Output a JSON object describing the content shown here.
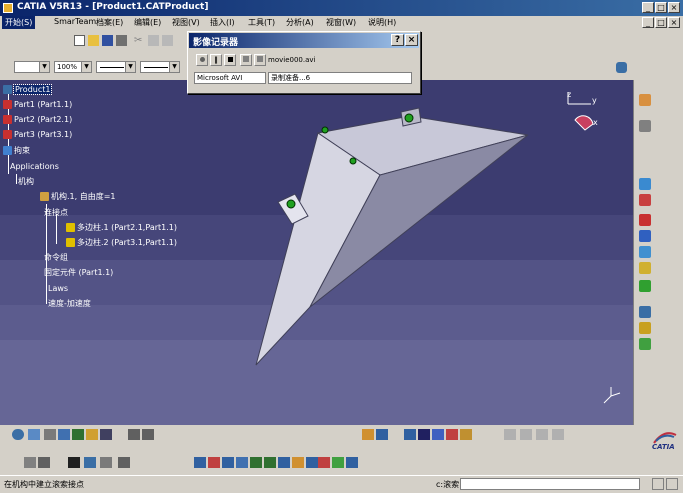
{
  "window": {
    "title": "CATIA V5R13 - [Product1.CATProduct]",
    "controls": [
      "_",
      "□",
      "×"
    ],
    "inner_controls": [
      "_",
      "□",
      "×"
    ]
  },
  "menu": {
    "start": "开始(S)",
    "items": [
      "SmarTeam",
      "档案(E)",
      "编辑(E)",
      "视图(V)",
      "插入(I)",
      "工具(T)",
      "分析(A)",
      "视窗(W)",
      "说明(H)"
    ]
  },
  "toolbar": {
    "zoom_value": "100%"
  },
  "recorder_dialog": {
    "title": "影像记录器",
    "help_label": "?",
    "close_label": "×",
    "filename": "movie000.avi",
    "format": "Microsoft AVI",
    "status": "录制准备...6"
  },
  "tree": {
    "root": "Product1",
    "parts": [
      "Part1 (Part1.1)",
      "Part2 (Part2.1)",
      "Part3 (Part3.1)"
    ],
    "constraints": "拘束",
    "applications": "Applications",
    "mechanisms": "机构",
    "mechanism": "机构.1, 自由度=1",
    "joints_folder": "连接点",
    "joints": [
      "多边柱.1 (Part2.1,Part1.1)",
      "多边柱.2 (Part3.1,Part1.1)"
    ],
    "commands": "命令组",
    "fixed": "固定元件 (Part1.1)",
    "laws": "Laws",
    "speed": "速度-加速度"
  },
  "compass": {
    "axis_x": "x",
    "axis_y": "y",
    "axis_z": "z"
  },
  "brand": "CATIA",
  "status": {
    "message": "在机构中建立滚索接点",
    "command_label": "c:滚索"
  },
  "colors": {
    "viewport_bg": "#3c3c70",
    "titlebar": "#0a246a",
    "part_face_light": "#d6d6e2",
    "part_face_dark": "#8a8aa4"
  }
}
